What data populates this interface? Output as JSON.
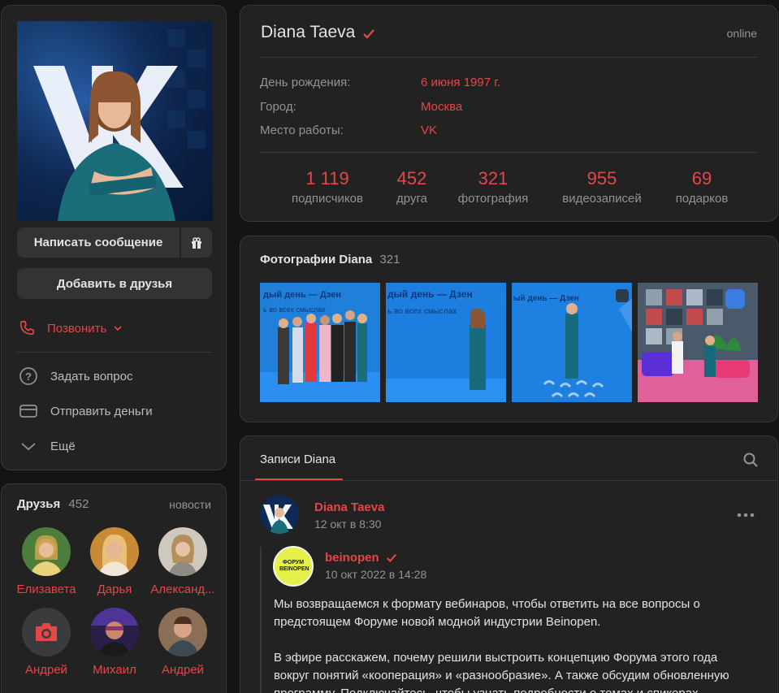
{
  "profile": {
    "name": "Diana Taeva",
    "status": "online",
    "details": [
      {
        "label": "День рождения:",
        "value": "6 июня 1997 г."
      },
      {
        "label": "Город:",
        "value": "Москва"
      },
      {
        "label": "Место работы:",
        "value": "VK"
      }
    ],
    "stats": [
      {
        "value": "1 119",
        "label": "подписчиков"
      },
      {
        "value": "452",
        "label": "друга"
      },
      {
        "value": "321",
        "label": "фотография"
      },
      {
        "value": "955",
        "label": "видеозаписей"
      },
      {
        "value": "69",
        "label": "подарков"
      }
    ]
  },
  "actions": {
    "message_label": "Написать сообщение",
    "add_friend_label": "Добавить в друзья",
    "call_label": "Позвонить",
    "ask_label": "Задать вопрос",
    "send_money_label": "Отправить деньги",
    "more_label": "Ещё"
  },
  "friends": {
    "title": "Друзья",
    "count": "452",
    "news_label": "новости",
    "items": [
      {
        "name": "Елизавета"
      },
      {
        "name": "Дарья"
      },
      {
        "name": "Александ..."
      },
      {
        "name": "Андрей"
      },
      {
        "name": "Михаил"
      },
      {
        "name": "Андрей"
      }
    ]
  },
  "photos": {
    "title": "Фотографии Diana",
    "count": "321",
    "banner_text_1": "дый день — Дзен",
    "banner_text_2": "ь во всех смыслах",
    "banner_text_3": "ый день — Дзен"
  },
  "wall": {
    "tab_label": "Записи Diana",
    "post": {
      "author": "Diana Taeva",
      "time": "12 окт в 8:30",
      "repost_author": "beinopen",
      "repost_time": "10 окт 2022 в 14:28",
      "repost_logo_text": "ФОРУМ BEINOPEN",
      "paragraph_1": "Мы возвращаемся к формату вебинаров, чтобы ответить на все вопросы о предстоящем Форуме новой модной индустрии Beinopen.",
      "paragraph_2": "В эфире расскажем, почему решили выстроить концепцию Форума этого года вокруг понятий «кооперация» и «разнообразие». А также обсудим обновленную программу. Подключайтесь, чтобы узнать подробности о темах и спикерах."
    }
  },
  "colors": {
    "accent": "#e64646",
    "card": "#222222",
    "background": "#141414"
  }
}
